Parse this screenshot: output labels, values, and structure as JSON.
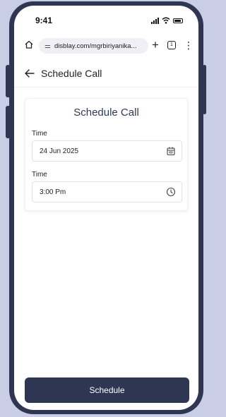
{
  "status_bar": {
    "time": "9:41"
  },
  "browser": {
    "url": "disblay.com/mgrbiriyanika...",
    "tab_count": "1"
  },
  "header": {
    "title": "Schedule Call"
  },
  "card": {
    "title": "Schedule Call",
    "date_label": "Time",
    "date_value": "24 Jun 2025",
    "time_label": "Time",
    "time_value": "3:00 Pm"
  },
  "actions": {
    "schedule_label": "Schedule"
  },
  "colors": {
    "accent": "#2e3652",
    "background": "#c9cde6"
  },
  "icons": {
    "home": "home-icon",
    "tune": "tune-icon",
    "plus": "plus-icon",
    "tabs": "tabs-icon",
    "menu": "more-vertical-icon",
    "back": "arrow-left-icon",
    "calendar": "calendar-icon",
    "clock": "clock-icon"
  }
}
